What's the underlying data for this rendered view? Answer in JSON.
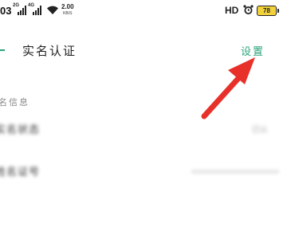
{
  "status_bar": {
    "time": "03",
    "signals": [
      {
        "tag": "2G"
      },
      {
        "tag": "4G"
      }
    ],
    "speed_value": "2.00",
    "speed_unit": "KB/S",
    "hd": "HD",
    "battery": "78",
    "battery_color": "#f2d23a"
  },
  "header": {
    "title": "实名认证",
    "settings_label": "设置",
    "accent_color": "#2aa37a",
    "back_icon": "back-arrow-icon"
  },
  "content": {
    "section_label": "名信息",
    "rows": [
      {
        "label": "实名状态",
        "value": "已认"
      },
      {
        "label": "姓名证号",
        "value": ""
      }
    ]
  },
  "annotation": {
    "arrow_color": "#e8302a"
  }
}
